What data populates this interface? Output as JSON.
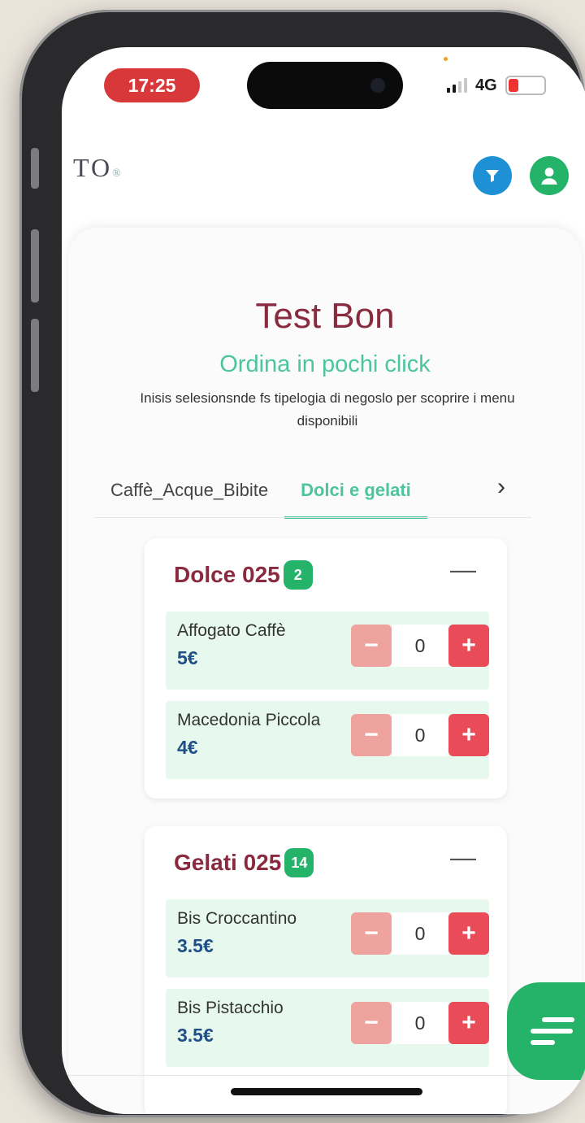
{
  "status_bar": {
    "time": "17:25",
    "network": "4G",
    "battery_level": "10",
    "time_pill_color": "#d9383a"
  },
  "header": {
    "logo_text": "TO",
    "logo_suffix": "®",
    "filter_icon": "filter-icon",
    "user_icon": "user-icon"
  },
  "page": {
    "title": "Test Bon",
    "subtitle": "Ordina in pochi click",
    "description": "Inisis selesionsnde fs tipelogia di negoslo per scoprire i menu disponibili"
  },
  "tabs": [
    {
      "label": "Caffè_Acque_Bibite",
      "active": false
    },
    {
      "label": "Dolci e gelati",
      "active": true
    }
  ],
  "groups": [
    {
      "name": "Dolce 025",
      "count": "2",
      "collapse_symbol": "—",
      "items": [
        {
          "name": "Affogato Caffè",
          "price": "5€",
          "qty": "0"
        },
        {
          "name": "Macedonia Piccola",
          "price": "4€",
          "qty": "0"
        }
      ]
    },
    {
      "name": "Gelati 025",
      "count": "14",
      "collapse_symbol": "—",
      "items": [
        {
          "name": "Bis Croccantino",
          "price": "3.5€",
          "qty": "0"
        },
        {
          "name": "Bis Pistacchio",
          "price": "3.5€",
          "qty": "0"
        }
      ]
    }
  ],
  "stepper": {
    "minus": "−",
    "plus": "+"
  },
  "colors": {
    "accent_green": "#4cc59a",
    "title_color": "#8a2a3e",
    "price_color": "#1f4f86",
    "plus_button": "#e94b59",
    "minus_button": "#eea39e"
  }
}
